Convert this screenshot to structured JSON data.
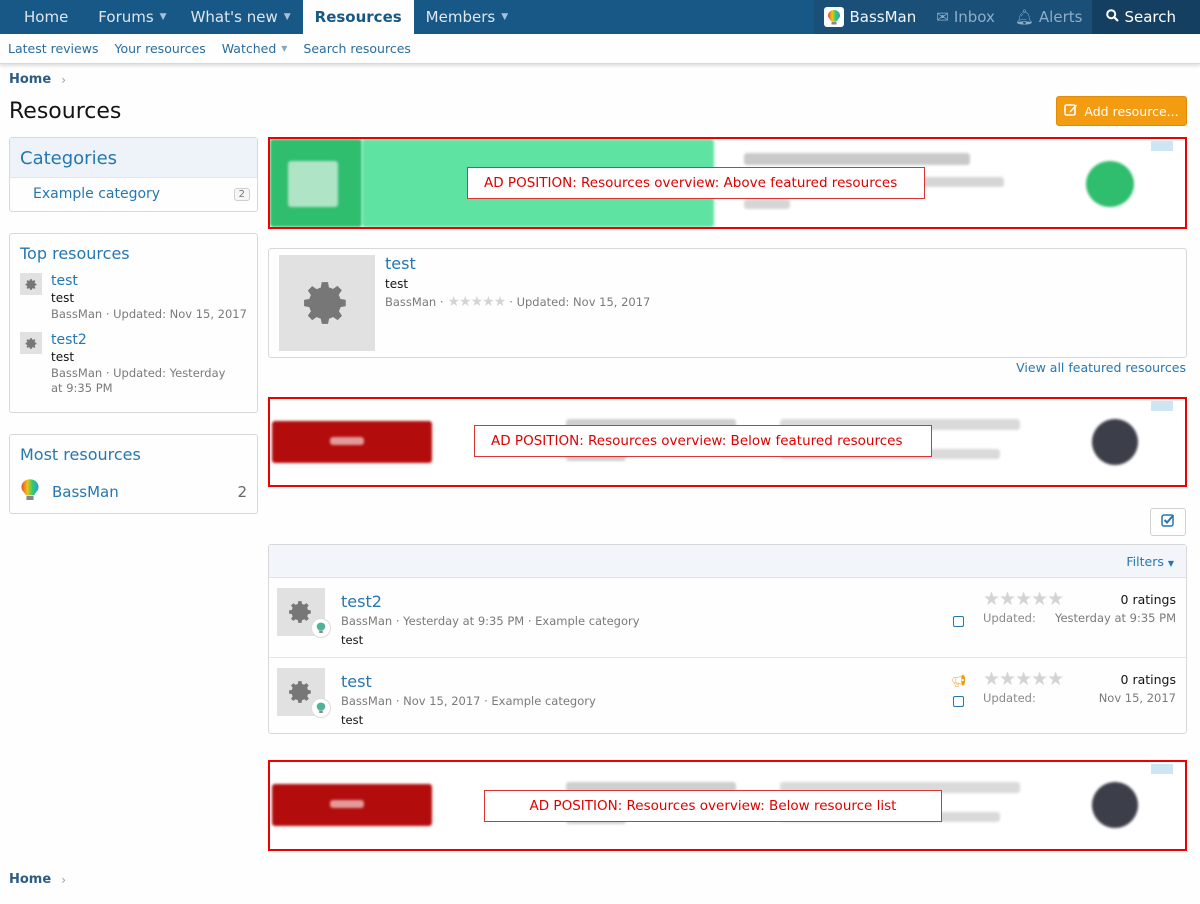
{
  "topnav": {
    "items": [
      {
        "label": "Home",
        "has_caret": false,
        "active": false
      },
      {
        "label": "Forums",
        "has_caret": true,
        "active": false
      },
      {
        "label": "What's new",
        "has_caret": true,
        "active": false
      },
      {
        "label": "Resources",
        "has_caret": false,
        "active": true
      },
      {
        "label": "Members",
        "has_caret": true,
        "active": false
      }
    ],
    "user": "BassMan",
    "inbox": "Inbox",
    "alerts": "Alerts",
    "search": "Search"
  },
  "subnav": {
    "latest_reviews": "Latest reviews",
    "your_resources": "Your resources",
    "watched": "Watched",
    "search_resources": "Search resources"
  },
  "breadcrumb": {
    "home": "Home"
  },
  "page": {
    "title": "Resources",
    "add_resource": "Add resource..."
  },
  "sidebar": {
    "categories": {
      "title": "Categories",
      "items": [
        {
          "label": "Example category",
          "count": "2"
        }
      ]
    },
    "top_resources": {
      "title": "Top resources",
      "items": [
        {
          "title": "test",
          "desc": "test",
          "meta": "BassMan · Updated: Nov 15, 2017"
        },
        {
          "title": "test2",
          "desc": "test",
          "meta": "BassMan · Updated: Yesterday at 9:35 PM"
        }
      ]
    },
    "most_resources": {
      "title": "Most resources",
      "user": "BassMan",
      "count": "2"
    }
  },
  "ads": {
    "above_featured": "AD POSITION: Resources overview: Above featured resources",
    "below_featured": "AD POSITION: Resources overview: Below featured resources",
    "below_list": "AD POSITION: Resources overview: Below resource list"
  },
  "featured": {
    "title": "test",
    "desc": "test",
    "author": "BassMan ·",
    "updated": "· Updated: Nov 15, 2017",
    "view_all": "View all featured resources"
  },
  "list": {
    "filters": "Filters",
    "rows": [
      {
        "title": "test2",
        "meta": "BassMan · Yesterday at 9:35 PM · Example category",
        "desc": "test",
        "ratings": "0 ratings",
        "updated_label": "Updated:",
        "updated": "Yesterday at 9:35 PM",
        "featured": false
      },
      {
        "title": "test",
        "meta": "BassMan · Nov 15, 2017 · Example category",
        "desc": "test",
        "ratings": "0 ratings",
        "updated_label": "Updated:",
        "updated": "Nov 15, 2017",
        "featured": true
      }
    ]
  },
  "footer": {
    "home": "Home"
  },
  "colors": {
    "nav_bg": "#185886",
    "accent": "#2577b1",
    "add_button": "#f39c12",
    "ad_border": "#ee0000"
  },
  "icons": {
    "user_avatar": "lightbulb-avatar-icon",
    "resource": "gear-icon",
    "add": "edit-icon",
    "moderate": "checkbox-icon"
  }
}
